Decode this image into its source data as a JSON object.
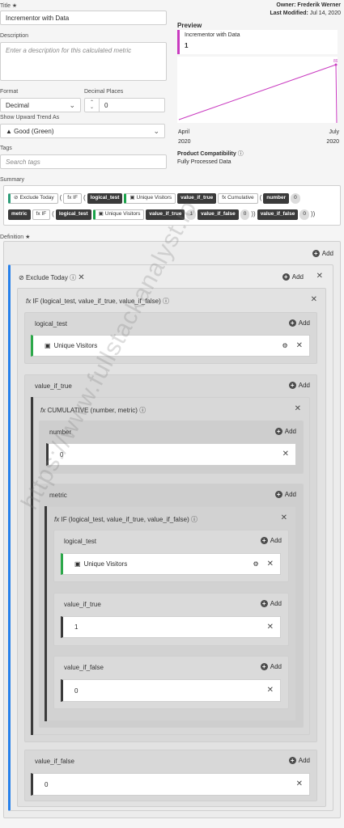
{
  "form": {
    "title_label": "Title ★",
    "title_value": "Incrementor with Data",
    "description_label": "Description",
    "description_placeholder": "Enter a description for this calculated metric",
    "format_label": "Format",
    "format_value": "Decimal",
    "decimal_label": "Decimal Places",
    "decimal_value": "0",
    "trend_label": "Show Upward Trend As",
    "trend_value": "▲ Good (Green)",
    "tags_label": "Tags",
    "tags_placeholder": "Search tags"
  },
  "meta": {
    "owner": "Owner: Frederik Werner",
    "modified_label": "Last Modified:",
    "modified_value": "Jul 14, 2020"
  },
  "preview": {
    "label": "Preview",
    "metric_name": "Incrementor with Data",
    "metric_value": "1",
    "x_start_month": "April",
    "x_start_year": "2020",
    "x_end_month": "July",
    "x_end_year": "2020",
    "end_point_label": "89",
    "line_color": "#c93bc0"
  },
  "compat": {
    "label": "Product Compatibility",
    "value": "Fully Processed Data"
  },
  "summary": {
    "label": "Summary",
    "row1": [
      "Exclude Today",
      "fx IF",
      "logical_test",
      "Unique Visitors",
      "value_if_true",
      "fx Cumulative",
      "number",
      "0"
    ],
    "row2": [
      "metric",
      "fx IF",
      "logical_test",
      "Unique Visitors",
      "value_if_true",
      "1",
      "value_if_false",
      "0",
      "value_if_false",
      "0"
    ]
  },
  "definition": {
    "label": "Definition ★",
    "add": "Add",
    "segment": "Exclude Today",
    "if_outer": "IF (logical_test, value_if_true, value_if_false)",
    "logical_test": "logical_test",
    "unique_visitors": "Unique Visitors",
    "value_if_true": "value_if_true",
    "cumulative": "CUMULATIVE (number, metric)",
    "number": "number",
    "zero": "0",
    "metric": "metric",
    "if_inner": "IF (logical_test, value_if_true, value_if_false)",
    "one": "1",
    "value_if_false": "value_if_false"
  },
  "watermark": "https://www.fullstackanalyst.io"
}
